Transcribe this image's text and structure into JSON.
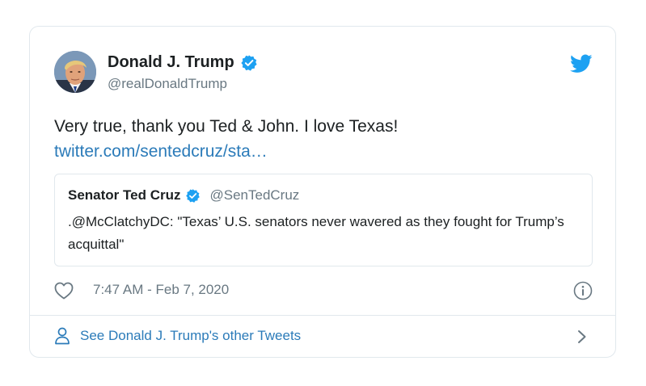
{
  "author": {
    "name": "Donald J. Trump",
    "handle": "@realDonaldTrump",
    "verified": true
  },
  "tweet": {
    "text": "Very true, thank you Ted & John. I love Texas!",
    "link": "twitter.com/sentedcruz/sta…"
  },
  "quoted_tweet": {
    "name": "Senator Ted Cruz",
    "handle": "@SenTedCruz",
    "verified": true,
    "text": ".@McClatchyDC: \"Texas’ U.S. senators never wavered as they fought for Trump’s acquittal\""
  },
  "meta": {
    "timestamp": "7:47 AM - Feb 7, 2020"
  },
  "footer": {
    "more_tweets_label": "See Donald J. Trump's other Tweets"
  },
  "colors": {
    "twitter_blue": "#1da1f2",
    "link_blue": "#2b7bb9",
    "secondary_text": "#697882",
    "border": "#e1e8ed"
  },
  "icons": [
    "avatar",
    "verified-badge-icon",
    "twitter-bird-icon",
    "heart-icon",
    "info-icon",
    "person-icon",
    "chevron-right-icon"
  ]
}
